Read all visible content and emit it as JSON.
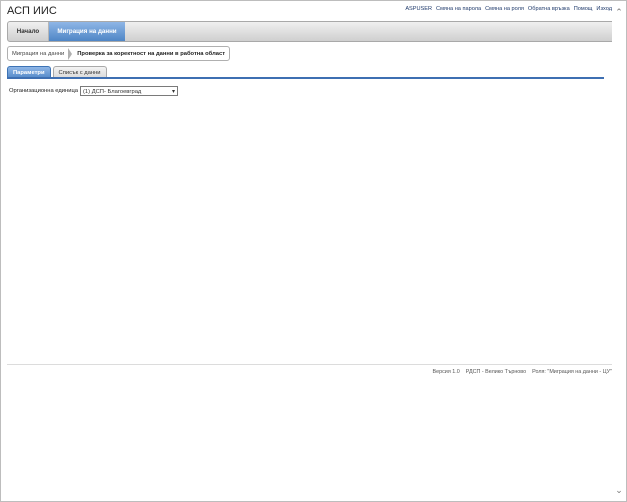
{
  "app": {
    "title": "АСП ИИС"
  },
  "top_links": [
    "ASPUSER",
    "Смяна на парола",
    "Смяна на роля",
    "Обратна връзка",
    "Помощ",
    "Изход"
  ],
  "nav": {
    "home": "Начало",
    "active": "Миграция на данни"
  },
  "breadcrumb": {
    "parent": "Миграция на данни",
    "current": "Проверка за коректност на данни в работна област"
  },
  "tabs": {
    "params": "Параметри",
    "list": "Списък с данни"
  },
  "form": {
    "org_label": "Организационна единица",
    "org_value": "(1) ДСП- Благоевград"
  },
  "footer": {
    "version": "Версия 1.0",
    "office": "РДСП - Велико Търново",
    "role": "Роля: \"Миграция на данни - ЦУ\""
  },
  "colors": {
    "accent": "#4f86c6",
    "tab_line": "#3e6fb2"
  },
  "icons": {
    "scroll_up": "chevron-up-icon",
    "scroll_down": "chevron-down-icon",
    "select": "chevron-down-icon"
  }
}
